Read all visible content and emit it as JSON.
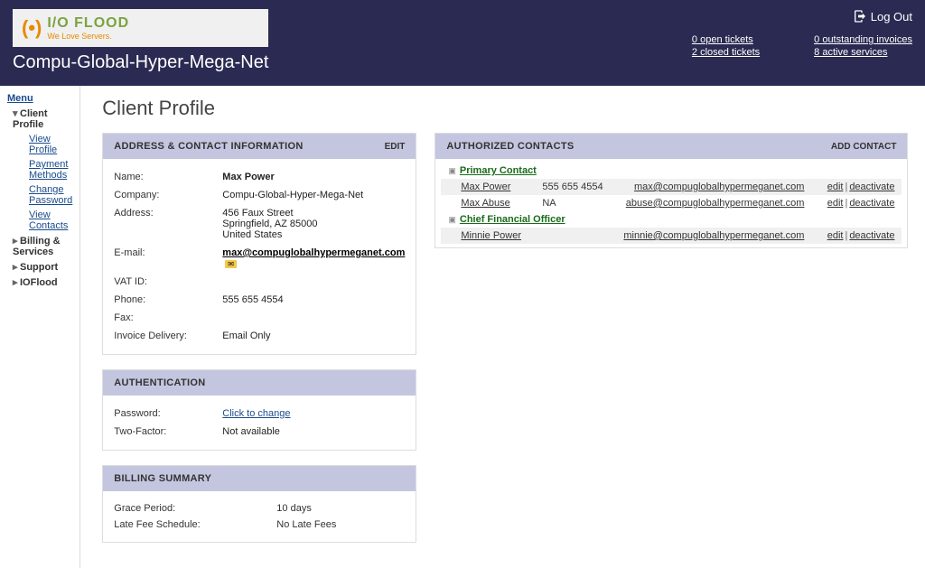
{
  "logo": {
    "brand": "I/O FLOOD",
    "tagline": "We Love Servers."
  },
  "company_name": "Compu-Global-Hyper-Mega-Net",
  "logout_label": "Log Out",
  "stats": {
    "open_tickets": {
      "count": "0",
      "label": " open tickets"
    },
    "closed_tickets": {
      "count": "2",
      "label": " closed tickets"
    },
    "outstanding_invoices": {
      "count": "0",
      "label": " outstanding invoices"
    },
    "active_services": {
      "count": "8",
      "label": " active services"
    }
  },
  "menu": {
    "title": "Menu",
    "items": {
      "client_profile": "Client Profile",
      "view_profile": "View Profile",
      "payment_methods": "Payment Methods",
      "change_password": "Change Password",
      "view_contacts": "View Contacts",
      "billing_services": "Billing & Services",
      "support": "Support",
      "ioflood": "IOFlood"
    }
  },
  "page_title": "Client Profile",
  "panels": {
    "address": {
      "title": "ADDRESS & CONTACT INFORMATION",
      "action": "EDIT",
      "fields": {
        "name_label": "Name:",
        "name_value": "Max Power",
        "company_label": "Company:",
        "company_value": "Compu-Global-Hyper-Mega-Net",
        "address_label": "Address:",
        "addr_line1": "456 Faux Street",
        "addr_line2": "Springfield, AZ 85000",
        "addr_line3": "United States",
        "email_label": "E-mail:",
        "email_value": "max@compuglobalhypermeganet.com",
        "vat_label": "VAT ID:",
        "vat_value": "",
        "phone_label": "Phone:",
        "phone_value": "555 655 4554",
        "fax_label": "Fax:",
        "fax_value": "",
        "invoice_label": "Invoice Delivery:",
        "invoice_value": "Email Only"
      }
    },
    "auth": {
      "title": "AUTHENTICATION",
      "password_label": "Password:",
      "password_value": "Click to change",
      "twofactor_label": "Two-Factor:",
      "twofactor_value": "Not available"
    },
    "billing": {
      "title": "BILLING SUMMARY",
      "grace_label": "Grace Period:",
      "grace_value": "10 days",
      "latefee_label": "Late Fee Schedule:",
      "latefee_value": "No Late Fees"
    },
    "contacts": {
      "title": "AUTHORIZED CONTACTS",
      "action": "ADD CONTACT",
      "primary_role": "Primary Contact",
      "cfo_role": "Chief Financial Officer",
      "edit": "edit",
      "deactivate": "deactivate",
      "rows": [
        {
          "name": "Max Power",
          "phone": "555 655 4554",
          "email": "max@compuglobalhypermeganet.com"
        },
        {
          "name": "Max Abuse",
          "phone": "NA",
          "email": "abuse@compuglobalhypermeganet.com"
        },
        {
          "name": "Minnie Power",
          "phone": "",
          "email": "minnie@compuglobalhypermeganet.com"
        }
      ]
    }
  }
}
